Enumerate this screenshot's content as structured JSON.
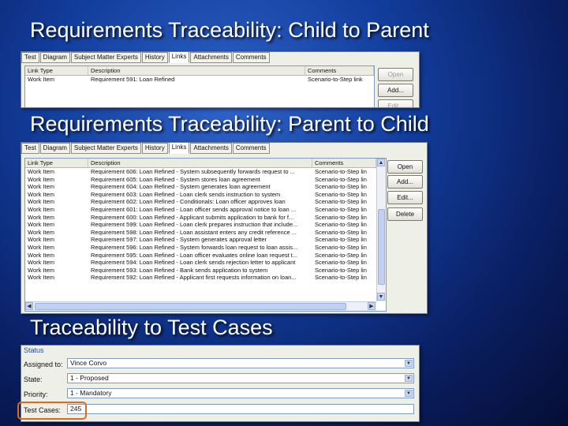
{
  "titles": {
    "child_to_parent": "Requirements Traceability: Child to Parent",
    "parent_to_child": "Requirements Traceability: Parent to Child",
    "test_cases": "Traceability to Test Cases"
  },
  "panel1": {
    "tabs": [
      "Test",
      "Diagram",
      "Subject Matter Experts",
      "History",
      "Links",
      "Attachments",
      "Comments"
    ],
    "active_tab": "Links",
    "columns": [
      "Link Type",
      "Description",
      "Comments"
    ],
    "rows": [
      [
        "Work Item",
        "Requirement 591: Loan Refined",
        "Scenario-to-Step link"
      ]
    ],
    "buttons": {
      "open": "Open",
      "add": "Add...",
      "edit": "Edit..."
    }
  },
  "panel2": {
    "tabs": [
      "Test",
      "Diagram",
      "Subject Matter Experts",
      "History",
      "Links",
      "Attachments",
      "Comments"
    ],
    "active_tab": "Links",
    "columns": [
      "Link Type",
      "Description",
      "Comments"
    ],
    "rows": [
      [
        "Work Item",
        "Requirement 606: Loan Refined - System subsequently forwards request to ...",
        "Scenario-to-Step lin"
      ],
      [
        "Work Item",
        "Requirement 605: Loan Refined - System stores loan agreement",
        "Scenario-to-Step lin"
      ],
      [
        "Work Item",
        "Requirement 604: Loan Refined - System generates loan agreement",
        "Scenario-to-Step lin"
      ],
      [
        "Work Item",
        "Requirement 603: Loan Refined - Loan clerk sends instruction to system",
        "Scenario-to-Step lin"
      ],
      [
        "Work Item",
        "Requirement 602: Loan Refined - Conditionals: Loan officer approves loan",
        "Scenario-to-Step lin"
      ],
      [
        "Work Item",
        "Requirement 601: Loan Refined - Loan officer sends approval notice to loan ...",
        "Scenario-to-Step lin"
      ],
      [
        "Work Item",
        "Requirement 600: Loan Refined - Applicant submits application to bank for f...",
        "Scenario-to-Step lin"
      ],
      [
        "Work Item",
        "Requirement 599: Loan Refined - Loan clerk prepares instruction that include...",
        "Scenario-to-Step lin"
      ],
      [
        "Work Item",
        "Requirement 598: Loan Refined - Loan assistant enters any credit reference ...",
        "Scenario-to-Step lin"
      ],
      [
        "Work Item",
        "Requirement 597: Loan Refined - System generates approval letter",
        "Scenario-to-Step lin"
      ],
      [
        "Work Item",
        "Requirement 596: Loan Refined - System forwards loan request to loan assis...",
        "Scenario-to-Step lin"
      ],
      [
        "Work Item",
        "Requirement 595: Loan Refined - Loan officer evaluates online loan request t...",
        "Scenario-to-Step lin"
      ],
      [
        "Work Item",
        "Requirement 594: Loan Refined - Loan clerk sends rejection letter to applicant",
        "Scenario-to-Step lin"
      ],
      [
        "Work Item",
        "Requirement 593: Loan Refined - Bank sends application to system",
        "Scenario-to-Step lin"
      ],
      [
        "Work Item",
        "Requirement 592: Loan Refined - Applicant first requests information on loan...",
        "Scenario-to-Step lin"
      ]
    ],
    "buttons": {
      "open": "Open",
      "add": "Add...",
      "edit": "Edit...",
      "delete": "Delete"
    }
  },
  "panel3": {
    "section": "Status",
    "fields": {
      "assigned_to": {
        "label": "Assigned to:",
        "value": "Vince Corvo"
      },
      "state": {
        "label": "State:",
        "value": "1 - Proposed"
      },
      "priority": {
        "label": "Priority:",
        "value": "1 - Mandatory"
      },
      "test_cases": {
        "label": "Test Cases:",
        "value": "245"
      }
    }
  },
  "colors": {
    "highlight": "#e06a1b",
    "title_text": "#ffffff"
  },
  "icons": {
    "dropdown": "chevron-down-icon",
    "scroll_up": "arrow-up-icon",
    "scroll_down": "arrow-down-icon",
    "scroll_left": "arrow-left-icon",
    "scroll_right": "arrow-right-icon"
  }
}
